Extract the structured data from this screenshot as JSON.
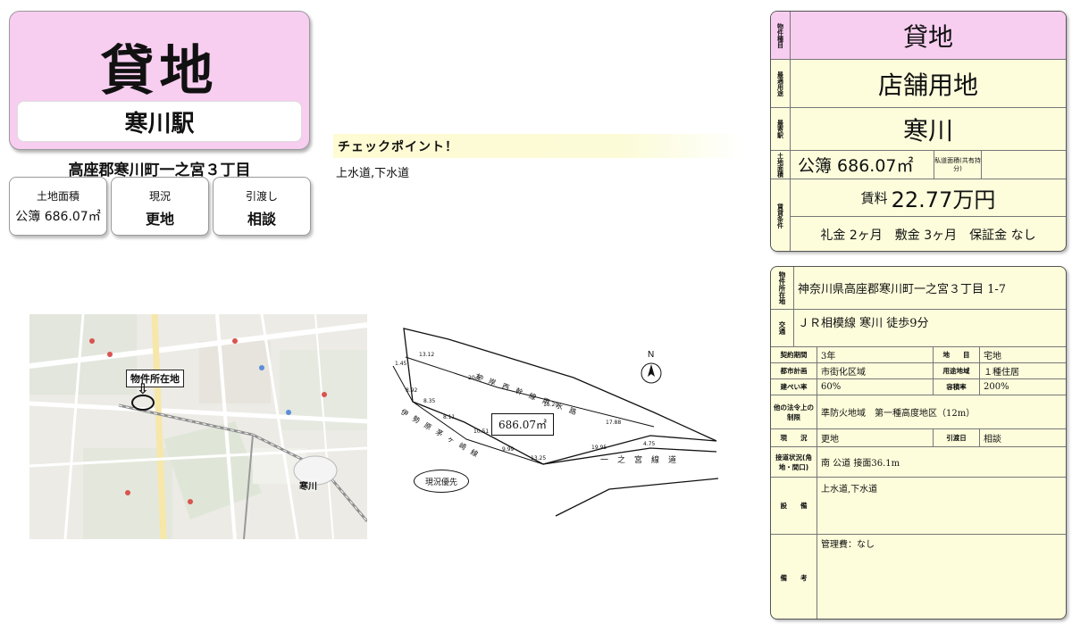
{
  "header": {
    "title": "貸地",
    "station": "寒川駅",
    "address": "高座郡寒川町一之宮３丁目"
  },
  "mini_cards": [
    {
      "label": "土地面積",
      "value": "公簿 686.07㎡"
    },
    {
      "label": "現況",
      "value": "更地"
    },
    {
      "label": "引渡し",
      "value": "相談"
    }
  ],
  "checkpoint": {
    "title": "チェックポイント！",
    "text": "上水道,下水道"
  },
  "map": {
    "label": "物件所在地",
    "arrow": "⇩",
    "station": "寒川"
  },
  "plot": {
    "area": "686.07㎡",
    "priority": "現況優先",
    "north": "N",
    "dimensions": [
      "13.12",
      "20.40",
      "15.20",
      "17.88",
      "4.75",
      "19.95",
      "13.25",
      "8.92",
      "8.35",
      "8.11",
      "10.51",
      "9.99",
      "1.45"
    ],
    "road_labels": [
      "一之宮線道",
      "左岸西幹線用水路",
      "伊勢原茅ヶ崎線"
    ]
  },
  "summary": {
    "type_label": "物件種目",
    "type_value": "貸地",
    "use_label": "最適用途",
    "use_value": "店舗用地",
    "station_label": "最寄駅",
    "station_value": "寒川",
    "area_label": "土地面積",
    "area_value": "公簿 686.07㎡",
    "private_road_label": "私道面積(共有持分)",
    "lease_label": "賃貸条件",
    "rent_label": "賃料",
    "rent_value": "22.77万円",
    "deposits": "礼金 2ヶ月　敷金 3ヶ月　保証金 なし"
  },
  "detail": {
    "location_label": "物件所在地",
    "location_value": "神奈川県高座郡寒川町一之宮３丁目 1-7",
    "transport_label": "交通",
    "transport_value": "ＪＲ相模線 寒川 徒歩9分",
    "contract_period_label": "契約期間",
    "contract_period_value": "3年",
    "land_category_label": "地　　目",
    "land_category_value": "宅地",
    "city_plan_label": "都市計画",
    "city_plan_value": "市街化区域",
    "zoning_label": "用途地域",
    "zoning_value": "１種住居",
    "coverage_label": "建ぺい率",
    "coverage_value": "60%",
    "far_label": "容積率",
    "far_value": "200%",
    "other_law_label": "他の法令上の制限",
    "other_law_value": "準防火地域　第一種高度地区（12m）",
    "current_label": "現　　況",
    "current_value": "更地",
    "handover_label": "引渡日",
    "handover_value": "相談",
    "road_label": "接道状況(角地・間口)",
    "road_value": "南 公道 接面36.1m",
    "facility_label": "設　　備",
    "facility_value": "上水道,下水道",
    "remarks_label": "備　　考",
    "remarks_value": "管理費：なし"
  }
}
